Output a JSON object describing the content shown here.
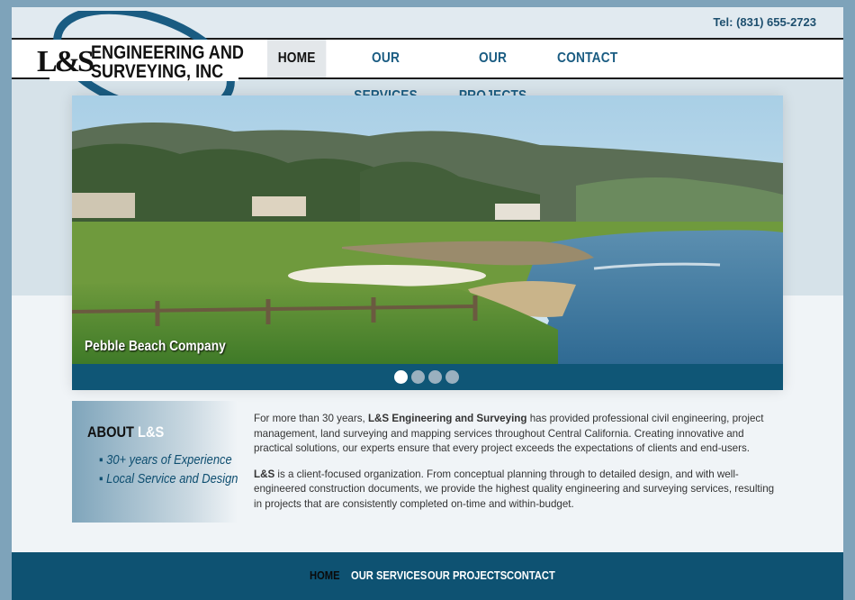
{
  "header": {
    "phone": "Tel: (831) 655-2723",
    "logo": {
      "mark": "L&S",
      "line1": "ENGINEERING AND",
      "line2": "SURVEYING, INC"
    }
  },
  "nav": {
    "items": [
      {
        "label": "HOME",
        "active": true
      },
      {
        "label": "OUR SERVICES",
        "active": false
      },
      {
        "label": "OUR PROJECTS",
        "active": false
      },
      {
        "label": "CONTACT",
        "active": false
      }
    ]
  },
  "slider": {
    "caption": "Pebble Beach Company",
    "slide_count": 4,
    "active_index": 0
  },
  "about": {
    "title_prefix": "ABOUT ",
    "title_accent": "L&S",
    "bullets": [
      "30+ years of Experience",
      "Local Service and Design"
    ],
    "paragraph1_pre": "For more than 30 years, ",
    "paragraph1_bold": "L&S Engineering and Surveying",
    "paragraph1_post": " has provided professional civil engineering, project management, land surveying and mapping services throughout Central California. Creating innovative and practical solutions, our experts ensure that every project exceeds the expectations of clients and end-users.",
    "paragraph2_bold": "L&S",
    "paragraph2_post": " is a client-focused organization. From conceptual planning through to detailed design, and with well-engineered construction documents, we provide the highest quality engineering and surveying services, resulting in projects that are consistently completed on-time and within-budget."
  },
  "footer": {
    "items": [
      {
        "label": "HOME",
        "active": true
      },
      {
        "label": "OUR SERVICES",
        "active": false
      },
      {
        "label": "OUR PROJECTS",
        "active": false
      },
      {
        "label": "CONTACT",
        "active": false
      }
    ]
  },
  "colors": {
    "brand_blue": "#0e5272",
    "nav_text": "#1a5c82",
    "page_bg": "#7ea3ba"
  }
}
